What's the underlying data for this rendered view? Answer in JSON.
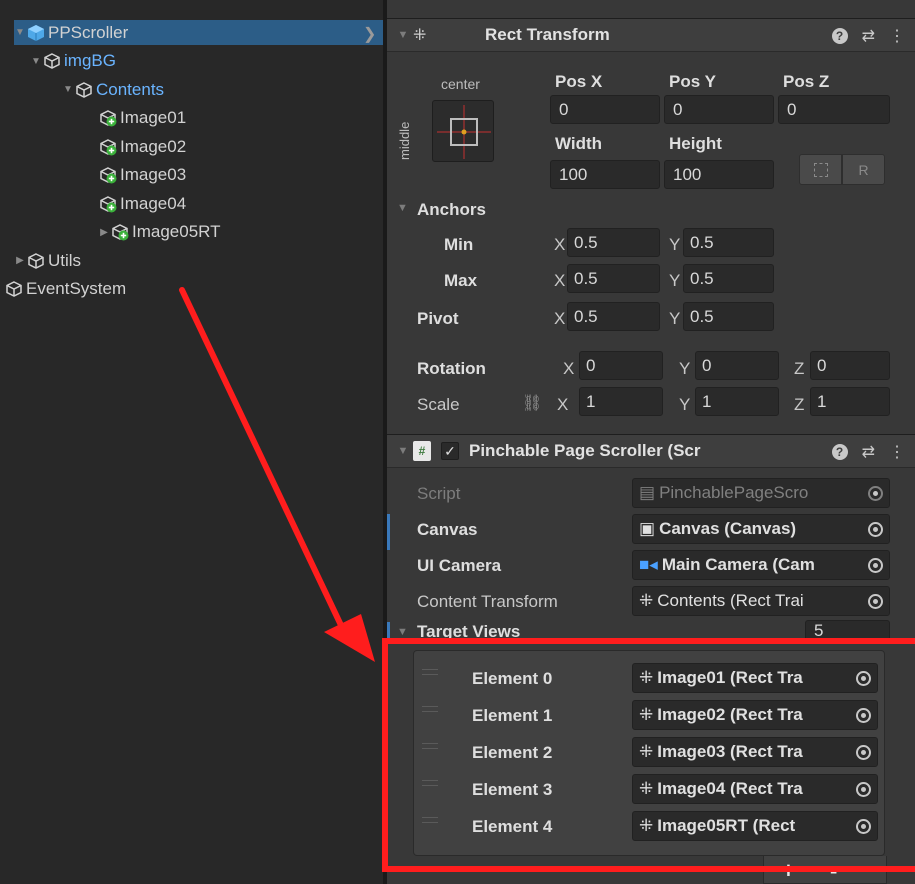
{
  "hierarchy": {
    "items": [
      {
        "label": "PPScroller",
        "indent": 0,
        "fold": "▼",
        "icon": "prefab-cube-icon",
        "selected": true
      },
      {
        "label": "imgBG",
        "indent": 1,
        "fold": "▼",
        "icon": "gameobject-icon",
        "blue": true
      },
      {
        "label": "Contents",
        "indent": 2,
        "fold": "▼",
        "icon": "gameobject-icon",
        "blue": true
      },
      {
        "label": "Image01",
        "indent": 3,
        "fold": "",
        "icon": "gameobject-added-icon"
      },
      {
        "label": "Image02",
        "indent": 3,
        "fold": "",
        "icon": "gameobject-added-icon"
      },
      {
        "label": "Image03",
        "indent": 3,
        "fold": "",
        "icon": "gameobject-added-icon"
      },
      {
        "label": "Image04",
        "indent": 3,
        "fold": "",
        "icon": "gameobject-added-icon"
      },
      {
        "label": "Image05RT",
        "indent": 3,
        "fold": "▶",
        "icon": "gameobject-added-icon"
      },
      {
        "label": "Utils",
        "indent": 0,
        "fold": "▶",
        "icon": "gameobject-icon"
      },
      {
        "label": "EventSystem",
        "indent": 0,
        "fold": "",
        "icon": "gameobject-icon"
      }
    ]
  },
  "rect_transform": {
    "title": "Rect Transform",
    "anchor_preset_h": "center",
    "anchor_preset_v": "middle",
    "pos_x_label": "Pos X",
    "pos_y_label": "Pos Y",
    "pos_z_label": "Pos Z",
    "pos_x": "0",
    "pos_y": "0",
    "pos_z": "0",
    "width_label": "Width",
    "height_label": "Height",
    "width": "100",
    "height": "100",
    "raw_button": "R",
    "anchors_label": "Anchors",
    "min_label": "Min",
    "max_label": "Max",
    "pivot_label": "Pivot",
    "x_axis": "X",
    "y_axis": "Y",
    "z_axis": "Z",
    "min_x": "0.5",
    "min_y": "0.5",
    "max_x": "0.5",
    "max_y": "0.5",
    "pivot_x": "0.5",
    "pivot_y": "0.5",
    "rotation_label": "Rotation",
    "rot_x": "0",
    "rot_y": "0",
    "rot_z": "0",
    "scale_label": "Scale",
    "scale_x": "1",
    "scale_y": "1",
    "scale_z": "1"
  },
  "component": {
    "title": "Pinchable Page Scroller (Scr",
    "script_label": "Script",
    "script_value": "PinchablePageScro",
    "canvas_label": "Canvas",
    "canvas_value": "Canvas (Canvas)",
    "camera_label": "UI Camera",
    "camera_value": "Main Camera (Cam",
    "content_label": "Content Transform",
    "content_value": "Contents (Rect Trai",
    "target_views_label": "Target Views",
    "target_views_count": "5",
    "elements": [
      {
        "label": "Element 0",
        "value": "Image01 (Rect Tra"
      },
      {
        "label": "Element 1",
        "value": "Image02 (Rect Tra"
      },
      {
        "label": "Element 2",
        "value": "Image03 (Rect Tra"
      },
      {
        "label": "Element 3",
        "value": "Image04 (Rect Tra"
      },
      {
        "label": "Element 4",
        "value": "Image05RT (Rect"
      }
    ],
    "add_label": "+",
    "remove_label": "-"
  },
  "colors": {
    "selection": "#2c5d87",
    "highlight_box": "#ff1d1d",
    "link_blue": "#6ab4ff"
  }
}
